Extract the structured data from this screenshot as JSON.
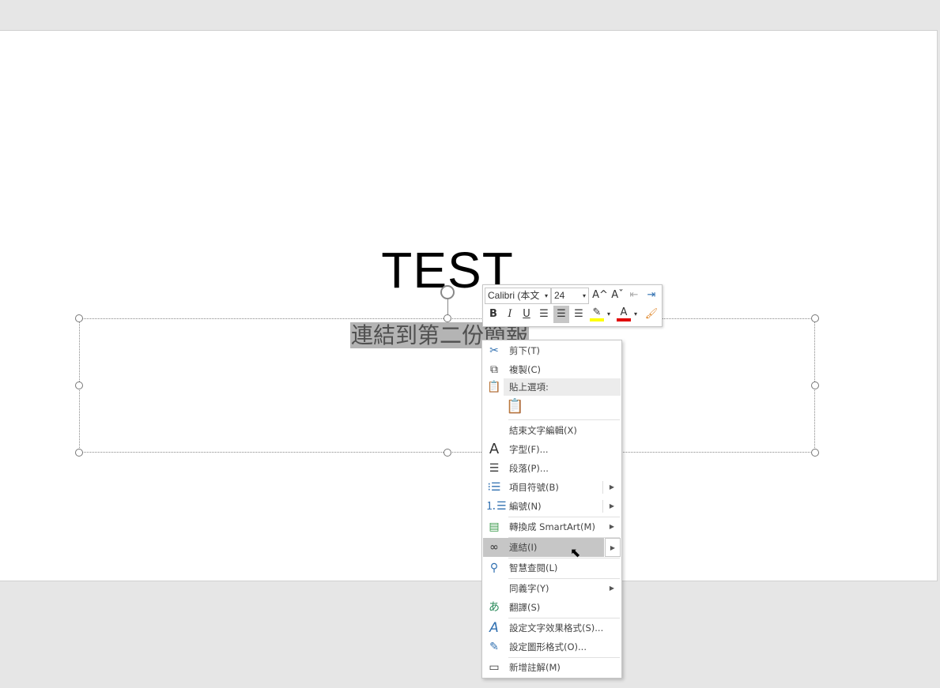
{
  "slide": {
    "title": "TEST",
    "subtitle": "連結到第二份簡報"
  },
  "mini_toolbar": {
    "font": "Calibri (本文",
    "size": "24",
    "buttons": {
      "grow": "A^",
      "shrink": "Aˇ",
      "bold": "B",
      "italic": "I",
      "underline": "U",
      "font_color": "A"
    },
    "highlight_color": "#ffff00",
    "font_color_value": "#e00000"
  },
  "menu": {
    "items": [
      {
        "label": "剪下(T)",
        "icon": "scissors-icon"
      },
      {
        "label": "複製(C)",
        "icon": "copy-icon"
      },
      {
        "label": "貼上選項:",
        "icon": "paste-icon"
      },
      {
        "label": "結束文字編輯(X)"
      },
      {
        "label": "字型(F)...",
        "icon": "font-icon"
      },
      {
        "label": "段落(P)...",
        "icon": "paragraph-icon"
      },
      {
        "label": "項目符號(B)",
        "icon": "bullets-icon"
      },
      {
        "label": "編號(N)",
        "icon": "numbering-icon"
      },
      {
        "label": "轉換成 SmartArt(M)",
        "icon": "smartart-icon"
      },
      {
        "label": "連結(I)",
        "icon": "link-icon"
      },
      {
        "label": "智慧查閱(L)",
        "icon": "smart-lookup-icon"
      },
      {
        "label": "同義字(Y)"
      },
      {
        "label": "翻譯(S)",
        "icon": "translate-icon"
      },
      {
        "label": "設定文字效果格式(S)...",
        "icon": "text-effects-icon"
      },
      {
        "label": "設定圖形格式(O)...",
        "icon": "format-shape-icon"
      },
      {
        "label": "新增註解(M)",
        "icon": "comment-icon"
      }
    ]
  }
}
